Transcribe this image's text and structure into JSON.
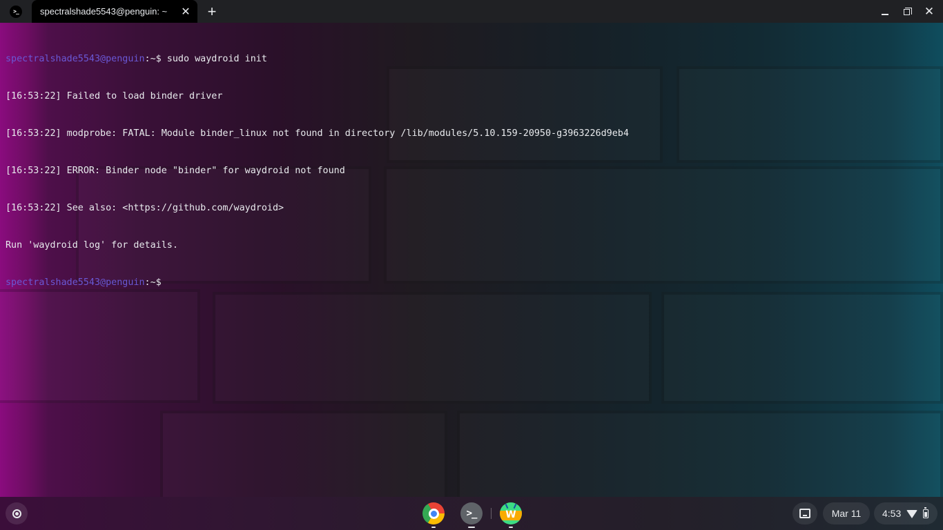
{
  "window": {
    "tab_title": "spectralshade5543@penguin: ~",
    "app_icon_label": ">_",
    "new_tab_label": "+",
    "close_tab_label": "✕",
    "close_window_label": "✕"
  },
  "terminal": {
    "prompt_user": "spectralshade5543@penguin",
    "prompt_path": ":~$",
    "command": " sudo waydroid init",
    "output": [
      "[16:53:22] Failed to load binder driver",
      "[16:53:22] modprobe: FATAL: Module binder_linux not found in directory /lib/modules/5.10.159-20950-g3963226d9eb4",
      "[16:53:22] ERROR: Binder node \"binder\" for waydroid not found",
      "[16:53:22] See also: <https://github.com/waydroid>",
      "Run 'waydroid log' for details."
    ],
    "final_prompt_user": "spectralshade5543@penguin",
    "final_prompt_path": ":~$"
  },
  "shelf": {
    "apps": [
      {
        "name": "chrome-icon",
        "running": true
      },
      {
        "name": "terminal-icon",
        "label": ">_",
        "running": true,
        "active": true
      },
      {
        "name": "waydroid-icon",
        "label": "W",
        "running": true
      }
    ],
    "date": "Mar 11",
    "time": "4:53"
  },
  "colors": {
    "prompt": "#6a58d6",
    "text": "#e8eaed",
    "titlebar": "#202124"
  }
}
